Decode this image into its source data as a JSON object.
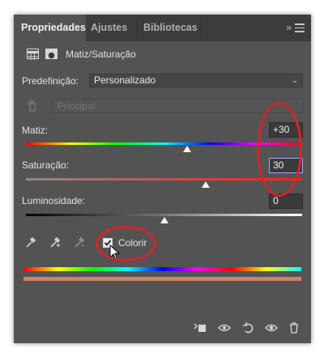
{
  "tabs": [
    {
      "label": "Propriedades",
      "active": true
    },
    {
      "label": "Ajustes",
      "active": false
    },
    {
      "label": "Bibliotecas",
      "active": false
    }
  ],
  "collapse_glyph": "»",
  "header": {
    "title": "Matiz/Saturação",
    "icons": [
      "adjustment-layer-icon",
      "layer-mask-icon"
    ]
  },
  "preset": {
    "label": "Predefinição:",
    "value": "Personalizado"
  },
  "channel": {
    "value": "Principal",
    "icon": "target-hand-icon"
  },
  "hue": {
    "label": "Matiz:",
    "value": "+30",
    "slider_fraction": 0.583
  },
  "saturation": {
    "label": "Saturação:",
    "value": "30",
    "slider_fraction": 0.65
  },
  "lightness": {
    "label": "Luminosidade:",
    "value": "0",
    "slider_fraction": 0.5
  },
  "tools": [
    "eyedropper-icon",
    "eyedropper-plus-icon",
    "eyedropper-minus-icon"
  ],
  "colorize": {
    "label": "Colorir",
    "checked": true
  },
  "footer_icons": [
    "clip-to-layer-icon",
    "view-previous-icon",
    "reset-icon",
    "visibility-icon",
    "delete-icon"
  ],
  "colors": {
    "panel": "#535353",
    "tabbar": "#3c3c3c",
    "annotation": "#d3262b",
    "colorize_bar": "#c8846a"
  }
}
